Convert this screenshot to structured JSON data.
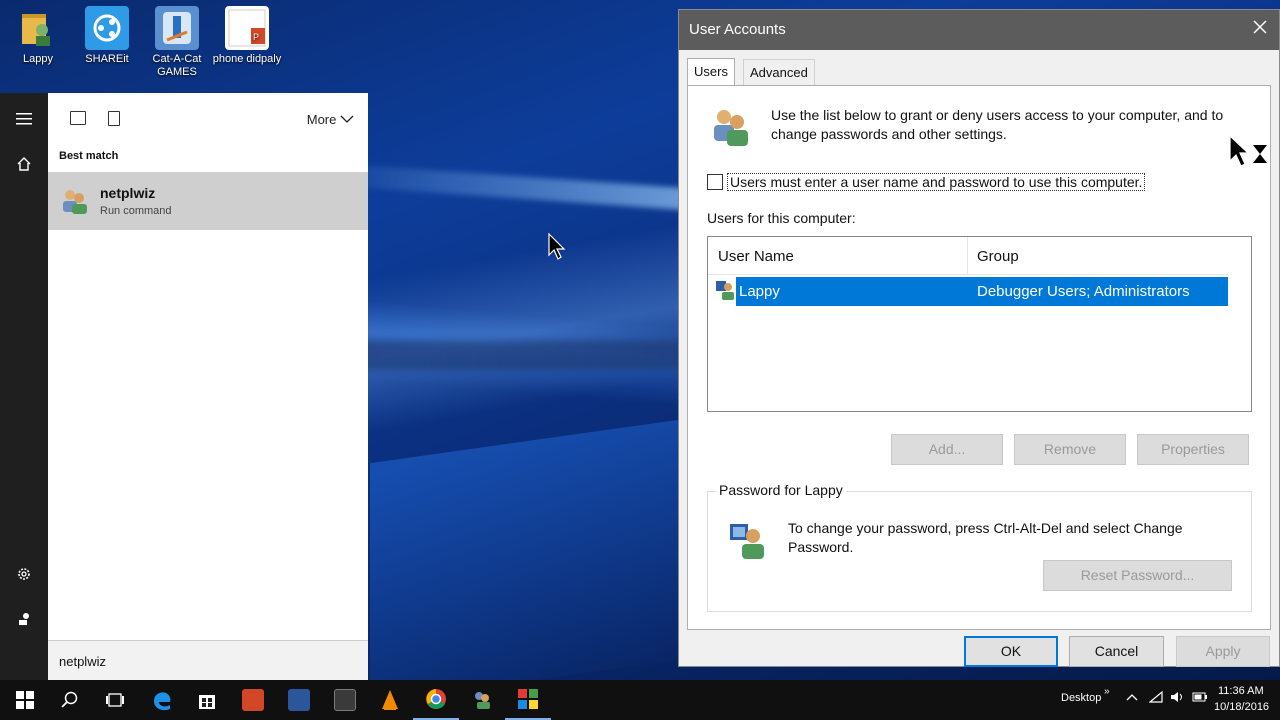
{
  "desktop": {
    "icons": [
      {
        "label": "Lappy",
        "color": "#e8b84a"
      },
      {
        "label": "SHAREit",
        "color": "#2f9be6"
      },
      {
        "label": "Cat-A-Cat GAMES",
        "color": "#5a8fd0"
      },
      {
        "label": "phone didpaly",
        "color": "#ffffff"
      }
    ]
  },
  "start": {
    "toolbar": {
      "more_label": "More"
    },
    "best_match_label": "Best match",
    "result": {
      "title": "netplwiz",
      "subtitle": "Run command"
    },
    "search_text": "netplwiz"
  },
  "dialog": {
    "title": "User Accounts",
    "tabs": [
      {
        "label": "Users",
        "active": true
      },
      {
        "label": "Advanced",
        "active": false
      }
    ],
    "intro_text": "Use the list below to grant or deny users access to your computer, and to change passwords and other settings.",
    "require_password_label": "Users must enter a user name and password to use this computer.",
    "require_password_checked": false,
    "users_label": "Users for this computer:",
    "columns": [
      "User Name",
      "Group"
    ],
    "rows": [
      {
        "user": "Lappy",
        "group": "Debugger Users; Administrators",
        "selected": true
      }
    ],
    "buttons": {
      "add": "Add...",
      "remove": "Remove",
      "properties": "Properties"
    },
    "password_group": {
      "title": "Password for Lappy",
      "text": "To change your password, press Ctrl-Alt-Del and select Change Password.",
      "reset_button": "Reset Password..."
    },
    "footer": {
      "ok": "OK",
      "cancel": "Cancel",
      "apply": "Apply"
    }
  },
  "taskbar": {
    "desktop_label": "Desktop",
    "time": "11:36 AM",
    "date": "10/18/2016",
    "accent": "#0078d7"
  }
}
